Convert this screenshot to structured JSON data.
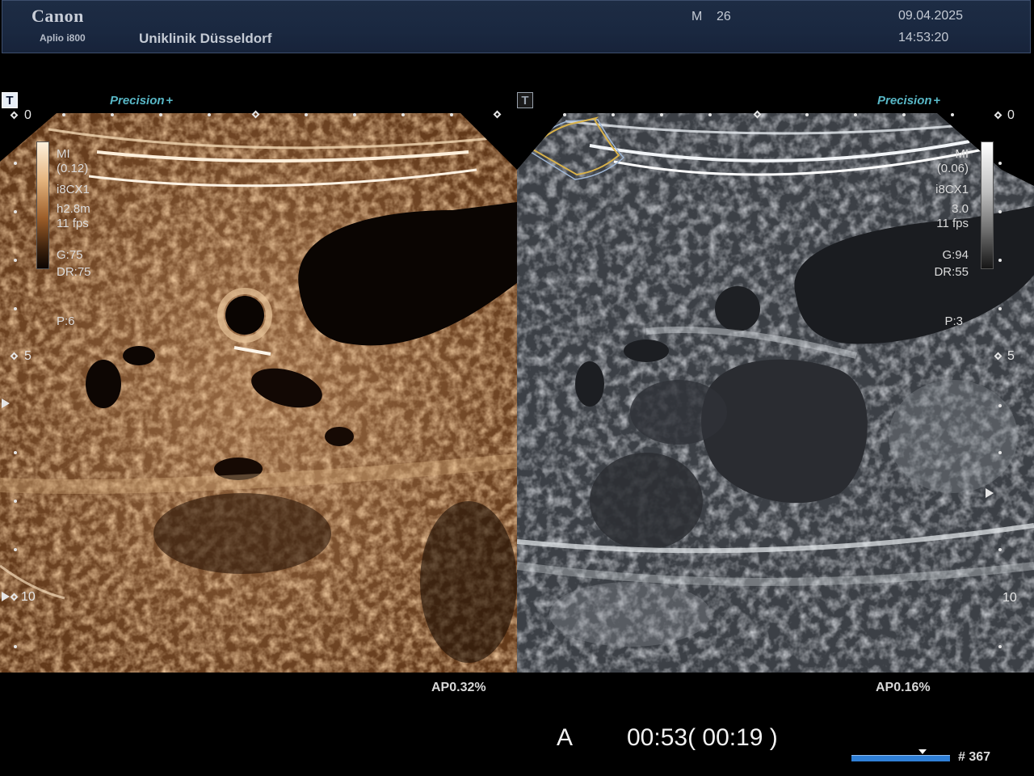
{
  "header": {
    "brand": "Canon",
    "model": "Aplio i800",
    "institution": "Uniklinik Düsseldorf",
    "patient_sex": "M",
    "patient_age": "26",
    "date": "09.04.2025",
    "time": "14:53:20"
  },
  "left_pane": {
    "mode_badge": "T",
    "preset": "Precision",
    "preset_suffix": "+",
    "params": [
      "MI",
      "(0.12)",
      "i8CX1",
      "h2.8m",
      "11 fps"
    ],
    "gain": "G:75",
    "dynamic_range": "DR:75",
    "power": "P:6",
    "depth_labels": [
      "0",
      "5",
      "10"
    ],
    "acoustic_power": "AP0.32%",
    "colormap": "sepia"
  },
  "right_pane": {
    "mode_badge": "T",
    "preset": "Precision",
    "preset_suffix": "+",
    "params": [
      "MI",
      "(0.06)",
      "i8CX1",
      "3.0",
      "11 fps"
    ],
    "gain": "G:94",
    "dynamic_range": "DR:55",
    "power": "P:3",
    "depth_labels": [
      "0",
      "5",
      "10"
    ],
    "acoustic_power": "AP0.16%",
    "colormap": "grayscale"
  },
  "footer": {
    "mode": "A",
    "elapsed": "00:53( 00:19 )",
    "frame_number": "# 367",
    "cine_position": 0.72
  },
  "colors": {
    "header_bg": "#1a2840",
    "precision_accent": "#58b7c6",
    "cine_bar": "#2f7fd6",
    "roi_outline": "#d9b24a"
  }
}
